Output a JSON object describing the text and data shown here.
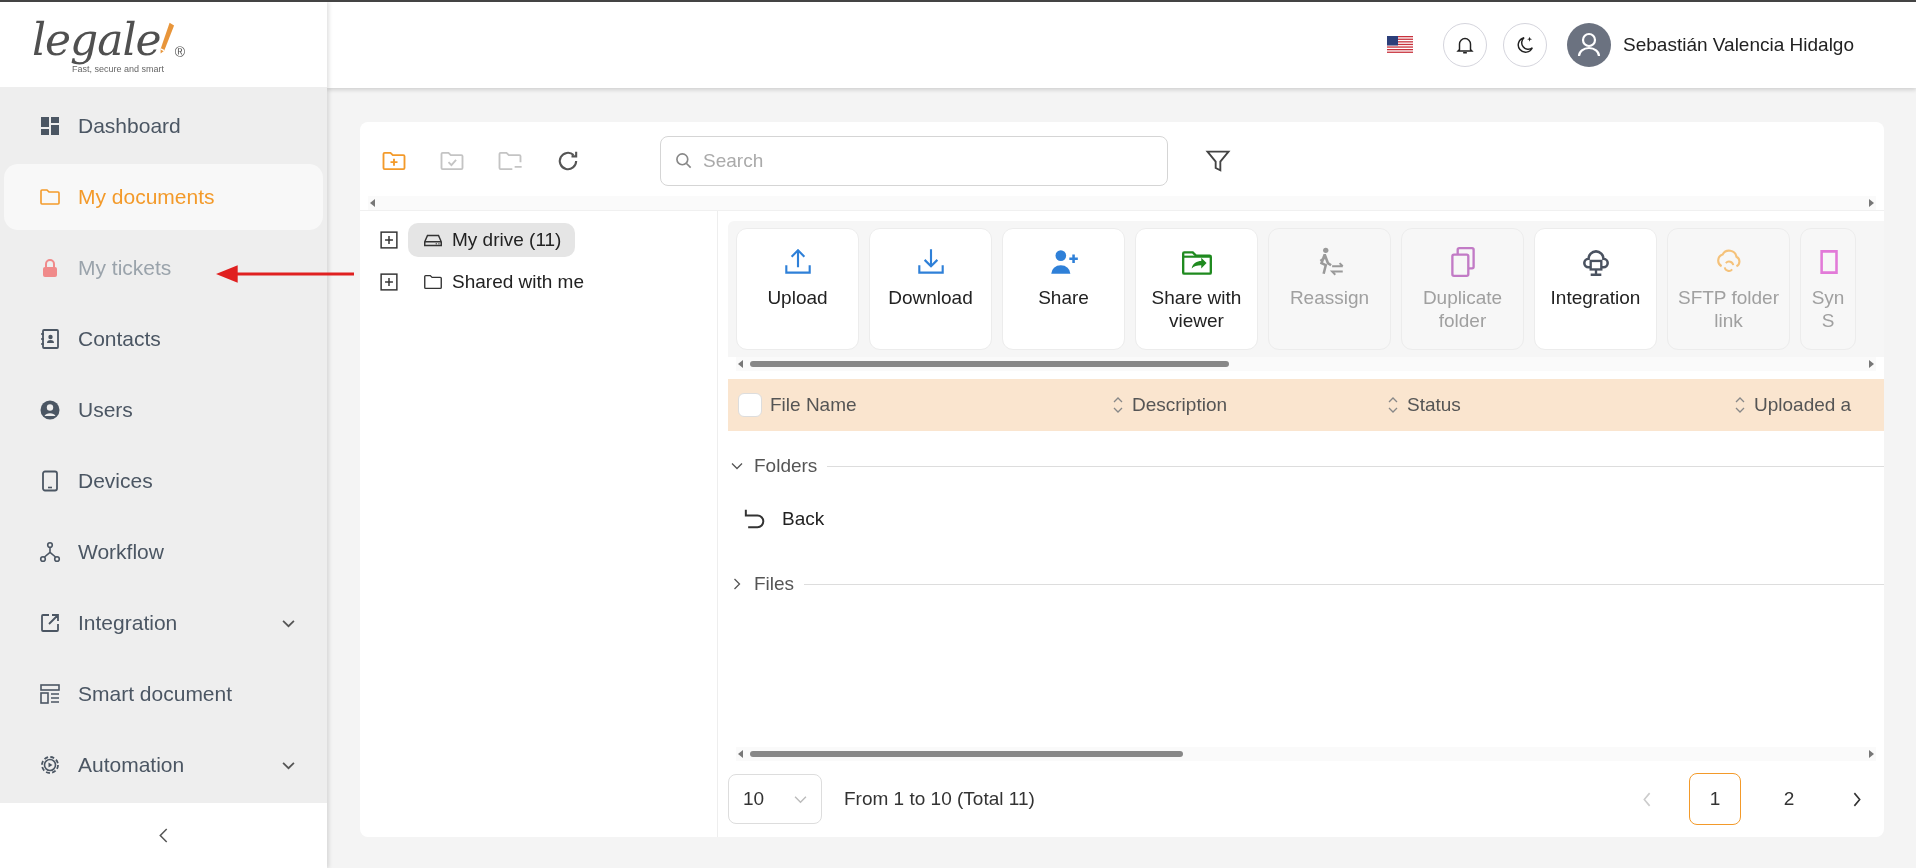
{
  "logo": {
    "name": "legale",
    "mark": "®",
    "tagline": "Fast, secure and smart"
  },
  "sidebar": {
    "items": [
      {
        "label": "Dashboard",
        "selected": false,
        "disabled": false,
        "has_submenu": false
      },
      {
        "label": "My documents",
        "selected": true,
        "disabled": false,
        "has_submenu": false
      },
      {
        "label": "My tickets",
        "selected": false,
        "disabled": true,
        "has_submenu": false
      },
      {
        "label": "Contacts",
        "selected": false,
        "disabled": false,
        "has_submenu": false
      },
      {
        "label": "Users",
        "selected": false,
        "disabled": false,
        "has_submenu": false
      },
      {
        "label": "Devices",
        "selected": false,
        "disabled": false,
        "has_submenu": false
      },
      {
        "label": "Workflow",
        "selected": false,
        "disabled": false,
        "has_submenu": false
      },
      {
        "label": "Integration",
        "selected": false,
        "disabled": false,
        "has_submenu": true
      },
      {
        "label": "Smart document",
        "selected": false,
        "disabled": false,
        "has_submenu": false
      },
      {
        "label": "Automation",
        "selected": false,
        "disabled": false,
        "has_submenu": true
      }
    ]
  },
  "header": {
    "user_name": "Sebastián Valencia Hidalgo"
  },
  "toolbar": [
    {
      "disabled": false
    },
    {
      "disabled": true
    },
    {
      "disabled": true
    },
    {
      "disabled": false
    }
  ],
  "search": {
    "placeholder": "Search"
  },
  "tree": [
    {
      "label": "My drive (11)",
      "selected": true,
      "expanded": false
    },
    {
      "label": "Shared with me",
      "selected": false,
      "expanded": false
    }
  ],
  "actions": [
    {
      "label": "Upload",
      "disabled": false,
      "color": "#2f80d8"
    },
    {
      "label": "Download",
      "disabled": false,
      "color": "#2f80d8"
    },
    {
      "label": "Share",
      "disabled": false,
      "color": "#2f80d8"
    },
    {
      "label": "Share with viewer",
      "disabled": false,
      "color": "#1f8a1f"
    },
    {
      "label": "Reassign",
      "disabled": true,
      "color": "#9a9a9a"
    },
    {
      "label": "Duplicate folder",
      "disabled": true,
      "color": "#c27bc6"
    },
    {
      "label": "Integration",
      "disabled": false,
      "color": "#4a5260"
    },
    {
      "label": "SFTP folder link",
      "disabled": true,
      "color": "#f5c27a"
    },
    {
      "label": "Syn S",
      "disabled": true,
      "color": "#e27ad8"
    }
  ],
  "table": {
    "all_checked": false,
    "columns": [
      {
        "label": "File Name",
        "sortable": false
      },
      {
        "label": "Description",
        "sortable": true
      },
      {
        "label": "Status",
        "sortable": true
      },
      {
        "label": "Uploaded a",
        "sortable": true
      }
    ],
    "groups": [
      {
        "label": "Folders",
        "expanded": true,
        "rows": [
          {
            "label": "Back"
          }
        ]
      },
      {
        "label": "Files",
        "expanded": false
      }
    ]
  },
  "pagination": {
    "page_size": "10",
    "info": "From 1 to 10 (Total 11)",
    "prev_disabled": true,
    "pages": [
      {
        "label": "1",
        "selected": true
      },
      {
        "label": "2",
        "selected": false
      }
    ]
  }
}
